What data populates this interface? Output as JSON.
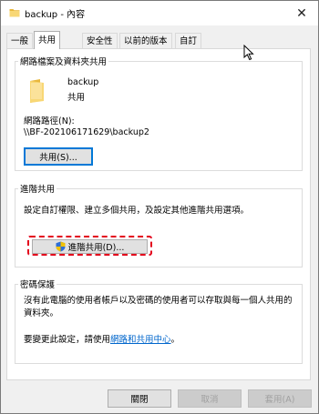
{
  "window": {
    "title": "backup - 內容",
    "close_glyph": "✕",
    "folder_icon": "folder-icon"
  },
  "tabs": [
    {
      "label": "一般"
    },
    {
      "label": "共用"
    },
    {
      "label": "安全性"
    },
    {
      "label": "以前的版本"
    },
    {
      "label": "自訂"
    }
  ],
  "active_tab": "共用",
  "network_section": {
    "legend": "網路檔案及資料夾共用",
    "folder_name": "backup",
    "folder_status": "共用",
    "path_label": "網路路徑(N):",
    "path_value": "\\\\BF-202106171629\\backup2",
    "share_button": "共用(S)..."
  },
  "advanced_section": {
    "legend": "進階共用",
    "description": "設定自訂權限、建立多個共用，及設定其他進階共用選項。",
    "advanced_button": "進階共用(D)..."
  },
  "password_section": {
    "legend": "密碼保護",
    "description": "沒有此電腦的使用者帳戶以及密碼的使用者可以存取與每一個人共用的資料夾。",
    "change_prefix": "要變更此設定，請使用",
    "link_text": "網路和共用中心",
    "change_suffix": "。"
  },
  "footer": {
    "close": "關閉",
    "cancel": "取消",
    "apply": "套用(A)"
  },
  "colors": {
    "focus_border": "#0078d7",
    "highlight": "#e3001b",
    "link": "#0066cc",
    "folder": "#f4c542"
  }
}
